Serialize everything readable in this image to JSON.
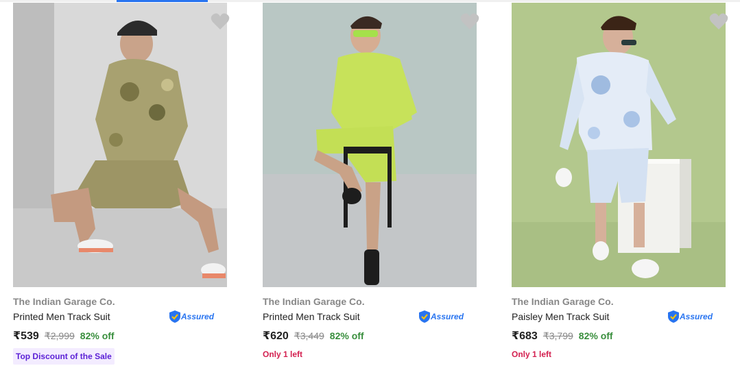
{
  "colors": {
    "brand_gray": "#878787",
    "title_text": "#212121",
    "assured_blue": "#2874f0",
    "assured_gold": "#ffc200",
    "discount_green": "#388e3c",
    "stock_red": "#d32050",
    "badge_purple": "#5a1fd6",
    "badge_bg": "#f3ecff",
    "wishlist_gray": "#c2c2c2"
  },
  "products": [
    {
      "brand": "The Indian Garage Co.",
      "title": "Printed Men Track Suit",
      "assured_label": "Assured",
      "price": "₹539",
      "mrp": "₹2,999",
      "discount": "82% off",
      "tag": "Top Discount of the Sale",
      "icon": "heart-icon"
    },
    {
      "brand": "The Indian Garage Co.",
      "title": "Printed Men Track Suit",
      "assured_label": "Assured",
      "price": "₹620",
      "mrp": "₹3,449",
      "discount": "82% off",
      "stock": "Only 1 left",
      "icon": "heart-icon"
    },
    {
      "brand": "The Indian Garage Co.",
      "title": "Paisley Men Track Suit",
      "assured_label": "Assured",
      "price": "₹683",
      "mrp": "₹3,799",
      "discount": "82% off",
      "stock": "Only 1 left",
      "icon": "heart-icon"
    }
  ]
}
